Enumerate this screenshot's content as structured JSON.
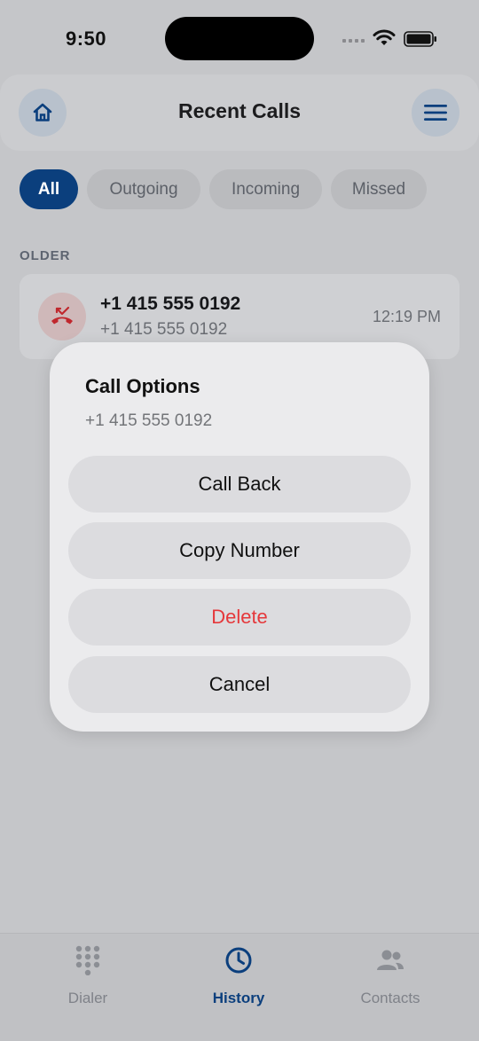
{
  "status_bar": {
    "time": "9:50"
  },
  "header": {
    "title": "Recent Calls",
    "home_icon": "home-icon",
    "menu_icon": "menu-icon"
  },
  "filters": [
    {
      "label": "All",
      "active": true
    },
    {
      "label": "Outgoing",
      "active": false
    },
    {
      "label": "Incoming",
      "active": false
    },
    {
      "label": "Missed",
      "active": false
    }
  ],
  "section": {
    "label": "OLDER"
  },
  "calls": [
    {
      "name": "+1 415 555 0192",
      "number": "+1 415 555 0192",
      "time": "12:19 PM",
      "icon": "missed-call-icon",
      "status_color": "#c0272d"
    }
  ],
  "modal": {
    "title": "Call Options",
    "subtitle": "+1 415 555 0192",
    "buttons": [
      {
        "label": "Call Back"
      },
      {
        "label": "Copy Number"
      },
      {
        "label": "Delete",
        "danger_color": "#e5383b"
      },
      {
        "label": "Cancel"
      }
    ]
  },
  "tabs": [
    {
      "label": "Dialer",
      "icon": "dialpad-icon",
      "active": false
    },
    {
      "label": "History",
      "icon": "clock-icon",
      "active": true
    },
    {
      "label": "Contacts",
      "icon": "people-icon",
      "active": false
    }
  ],
  "colors": {
    "accent": "#0b3f7d",
    "danger": "#e5383b"
  }
}
